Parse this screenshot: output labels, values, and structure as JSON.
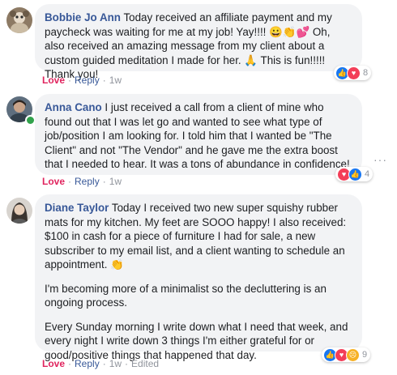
{
  "comments": [
    {
      "author": "Bobbie Jo Ann",
      "paragraphs": [
        "Today received an affiliate payment and my paycheck was waiting for me at my job! Yay!!!! 😀👏💕 Oh, also received an amazing message from my client about a custom guided meditation I made for her. 🙏 This is fun!!!!! Thank you!"
      ],
      "love": "Love",
      "reply": "Reply",
      "time": "1w",
      "edited": "",
      "reaction_count": "8"
    },
    {
      "author": "Anna Cano",
      "paragraphs": [
        "I just received a call from a client of mine who found out that I was let go and wanted to see what type of job/position I am looking for. I told him that I wanted be \"The Client\" and not \"The Vendor\" and he gave me the extra boost that I needed to hear. It was a tons of abundance in confidence!"
      ],
      "love": "Love",
      "reply": "Reply",
      "time": "1w",
      "edited": "",
      "reaction_count": "4"
    },
    {
      "author": "Diane Taylor",
      "paragraphs": [
        "Today I received two new super squishy rubber mats for my kitchen. My feet are SOOO happy! I also received: $100 in cash for a piece of furniture I had for sale, a new subscriber to my email list, and a client wanting to schedule an appointment. 👏",
        "I'm becoming more of a minimalist so the decluttering is an ongoing process.",
        "Every Sunday morning I write down what I need that week, and every night I write down 3 things I'm either grateful for or good/positive things that happened that day."
      ],
      "love": "Love",
      "reply": "Reply",
      "time": "1w",
      "edited": "Edited",
      "reaction_count": "9"
    }
  ],
  "more_icon": "···",
  "colors": {
    "author": "#385898",
    "love": "#e0245e",
    "bubble": "#f2f3f5",
    "meta": "#90949c"
  }
}
